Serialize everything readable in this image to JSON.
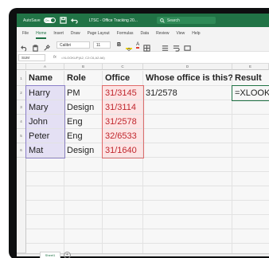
{
  "titlebar": {
    "autosave_label": "AutoSave",
    "autosave_state": "On",
    "doc_title": "LTSC - Office Tracking 20... ",
    "search_placeholder": "Search"
  },
  "ribbon_tabs": [
    "File",
    "Home",
    "Insert",
    "Draw",
    "Page Layout",
    "Formulas",
    "Data",
    "Review",
    "View",
    "Help"
  ],
  "active_tab": "Home",
  "toolbar": {
    "font_name": "Calibri",
    "font_size": "11",
    "bold_label": "B",
    "font_color_label": "A"
  },
  "formula_bar": {
    "name_box": "SUM",
    "fx_label": "fx",
    "formula": "=XLOOKUP(A2, C2:C6,A2:A6)"
  },
  "columns": [
    "A",
    "B",
    "C",
    "D",
    "E"
  ],
  "rows": [
    "1",
    "2",
    "3",
    "4",
    "5",
    "6"
  ],
  "headers": {
    "A": "Name",
    "B": "Role",
    "C": "Office",
    "D": "Whose office is this?",
    "E": "Result"
  },
  "data": [
    {
      "name": "Harry",
      "role": "PM",
      "office": "31/3145",
      "d": "31/2578",
      "e": "=XLOOKU"
    },
    {
      "name": "Mary",
      "role": "Design",
      "office": "31/3114",
      "d": "",
      "e": ""
    },
    {
      "name": "John",
      "role": "Eng",
      "office": "31/2578",
      "d": "",
      "e": ""
    },
    {
      "name": "Peter",
      "role": "Eng",
      "office": "32/6533",
      "d": "",
      "e": ""
    },
    {
      "name": "Mat",
      "role": "Design",
      "office": "31/1640",
      "d": "",
      "e": ""
    }
  ],
  "sheet_tab": "Sheet1",
  "add_sheet": "+",
  "colors": {
    "excel_green": "#217346",
    "ref1": "#e4e0f4",
    "ref2": "#fce4e4"
  }
}
